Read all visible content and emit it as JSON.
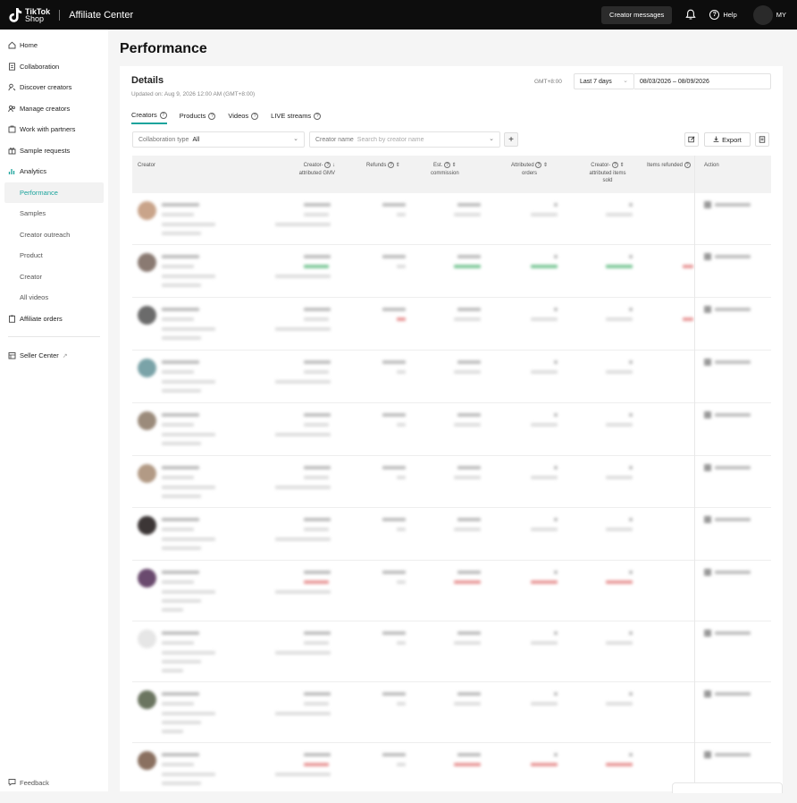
{
  "topbar": {
    "brand_line1": "TikTok",
    "brand_line2": "Shop",
    "app_title": "Affiliate Center",
    "messages_button": "Creator messages",
    "help_label": "Help",
    "user_initials": "MY"
  },
  "sidebar": {
    "items": [
      {
        "label": "Home",
        "icon": "home-icon"
      },
      {
        "label": "Collaboration",
        "icon": "document-icon"
      },
      {
        "label": "Discover creators",
        "icon": "person-search-icon"
      },
      {
        "label": "Manage creators",
        "icon": "people-icon"
      },
      {
        "label": "Work with partners",
        "icon": "handshake-icon"
      },
      {
        "label": "Sample requests",
        "icon": "gift-icon"
      },
      {
        "label": "Analytics",
        "icon": "chart-icon"
      }
    ],
    "analytics_sub": [
      "Performance",
      "Samples",
      "Creator outreach",
      "Product",
      "Creator",
      "All videos"
    ],
    "affiliate_orders": "Affiliate orders",
    "seller_center": "Seller Center",
    "feedback": "Feedback"
  },
  "page": {
    "title": "Performance",
    "details_title": "Details",
    "updated": "Updated on: Aug 9, 2026 12:00 AM (GMT+8:00)",
    "timezone": "GMT+8:00",
    "range_value": "Last 7 days",
    "date_range": "08/03/2026 – 08/09/2026"
  },
  "tabs": [
    "Creators",
    "Products",
    "Videos",
    "LIVE streams"
  ],
  "filters": {
    "collab_label": "Collaboration type",
    "collab_value": "All",
    "creator_label": "Creator name",
    "creator_placeholder": "Search by creator name",
    "export_label": "Export"
  },
  "table": {
    "headers": {
      "creator": "Creator",
      "gmv_1": "Creator-",
      "gmv_2": "attributed GMV",
      "refunds": "Refunds",
      "commission_1": "Est.",
      "commission_2": "commission",
      "orders_1": "Attributed",
      "orders_2": "orders",
      "items_1": "Creator-",
      "items_2": "attributed items",
      "items_3": "sold",
      "refunded": "Items refunded",
      "action": "Action"
    },
    "rows": [
      {
        "trend": "none",
        "avatar_color": "#c9a48a"
      },
      {
        "trend": "up",
        "avatar_color": "#8a7a72"
      },
      {
        "trend": "mixed",
        "avatar_color": "#6b6b6b"
      },
      {
        "trend": "none",
        "avatar_color": "#7aa3a8"
      },
      {
        "trend": "none",
        "avatar_color": "#9b8b7b"
      },
      {
        "trend": "none",
        "avatar_color": "#b29a85"
      },
      {
        "trend": "none",
        "avatar_color": "#3c3636"
      },
      {
        "trend": "down",
        "avatar_color": "#6a4a6e"
      },
      {
        "trend": "none",
        "avatar_color": "#e6e6e6"
      },
      {
        "trend": "none",
        "avatar_color": "#6b7560"
      },
      {
        "trend": "down",
        "avatar_color": "#8a7060"
      }
    ]
  }
}
